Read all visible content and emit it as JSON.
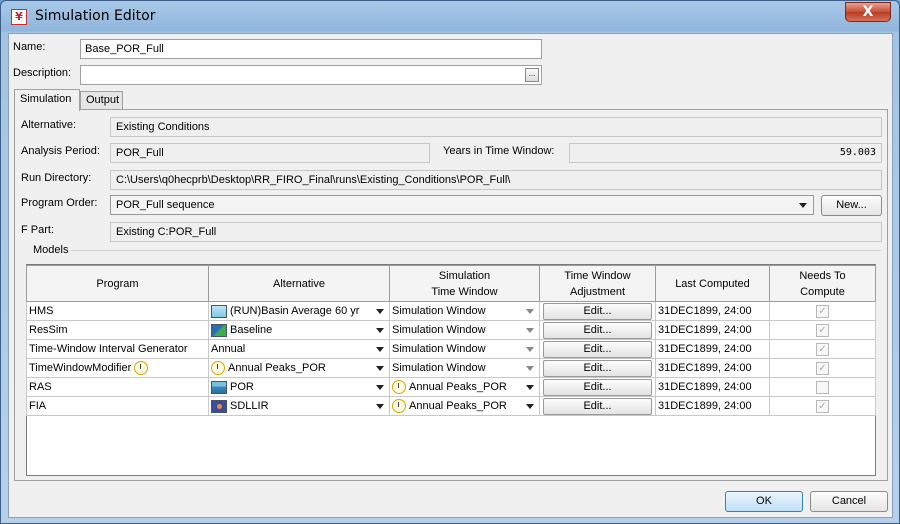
{
  "window": {
    "title": "Simulation Editor",
    "close_glyph": "X"
  },
  "form": {
    "name_label": "Name:",
    "name_value": "Base_POR_Full",
    "description_label": "Description:",
    "description_value": "",
    "browse_glyph": "..."
  },
  "tabs": [
    {
      "label": "Simulation",
      "active": true
    },
    {
      "label": "Output",
      "active": false
    }
  ],
  "simulation": {
    "alternative_label": "Alternative:",
    "alternative_value": "Existing Conditions",
    "analysis_period_label": "Analysis Period:",
    "analysis_period_value": "POR_Full",
    "years_label": "Years in Time Window:",
    "years_value": "59.003",
    "run_directory_label": "Run Directory:",
    "run_directory_value": "C:\\Users\\q0hecprb\\Desktop\\RR_FIRO_Final\\runs\\Existing_Conditions\\POR_Full\\",
    "program_order_label": "Program Order:",
    "program_order_value": "POR_Full sequence",
    "new_button": "New...",
    "fpart_label": "F Part:",
    "fpart_value": "Existing C:POR_Full",
    "models_label": "Models"
  },
  "models_table": {
    "headers": {
      "program": "Program",
      "alternative": "Alternative",
      "sim_tw_1": "Simulation",
      "sim_tw_2": "Time Window",
      "tw_adj_1": "Time Window",
      "tw_adj_2": "Adjustment",
      "last_computed": "Last Computed",
      "needs_1": "Needs To",
      "needs_2": "Compute"
    },
    "rows": [
      {
        "program": "HMS",
        "program_icon": "",
        "alt": "(RUN)Basin Average 60 yr",
        "alt_icon": "hms-model-icon",
        "stw": "Simulation Window",
        "stw_icon": "",
        "edit": "Edit...",
        "last": "31DEC1899, 24:00",
        "needs": "checked-disabled"
      },
      {
        "program": "ResSim",
        "program_icon": "",
        "alt": "Baseline",
        "alt_icon": "ressim-model-icon",
        "stw": "Simulation Window",
        "stw_icon": "",
        "edit": "Edit...",
        "last": "31DEC1899, 24:00",
        "needs": "checked-disabled"
      },
      {
        "program": "Time-Window Interval Generator",
        "program_icon": "",
        "alt": "Annual",
        "alt_icon": "",
        "stw": "Simulation Window",
        "stw_icon": "",
        "edit": "Edit...",
        "last": "31DEC1899, 24:00",
        "needs": "checked-disabled"
      },
      {
        "program": "TimeWindowModifier",
        "program_icon": "clock-icon",
        "alt": "Annual Peaks_POR",
        "alt_icon": "clock-icon",
        "stw": "Simulation Window",
        "stw_icon": "",
        "edit": "Edit...",
        "last": "31DEC1899, 24:00",
        "needs": "checked-disabled"
      },
      {
        "program": "RAS",
        "program_icon": "",
        "alt": "POR",
        "alt_icon": "ras-model-icon",
        "stw": "Annual Peaks_POR",
        "stw_icon": "clock-icon",
        "edit": "Edit...",
        "last": "31DEC1899, 24:00",
        "needs": "unchecked-disabled"
      },
      {
        "program": "FIA",
        "program_icon": "",
        "alt": "SDLLIR",
        "alt_icon": "fia-model-icon",
        "stw": "Annual Peaks_POR",
        "stw_icon": "clock-icon",
        "edit": "Edit...",
        "last": "31DEC1899, 24:00",
        "needs": "checked-disabled"
      }
    ]
  },
  "footer": {
    "ok": "OK",
    "cancel": "Cancel"
  }
}
